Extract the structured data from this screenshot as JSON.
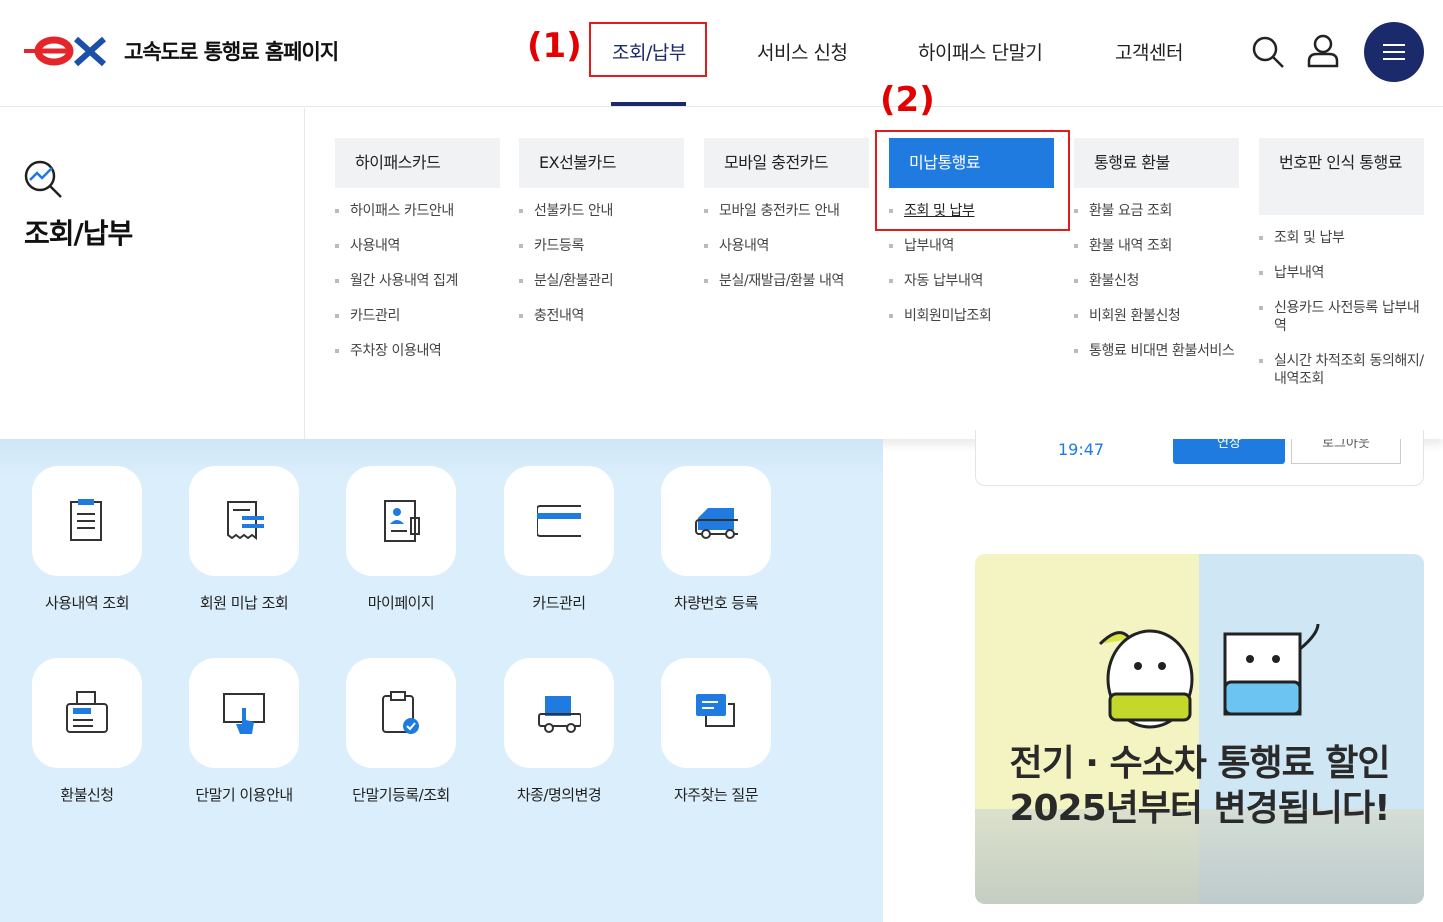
{
  "header": {
    "logo_mark": "ex",
    "site_title": "고속도로 통행료 홈페이지",
    "nav": [
      "조회/납부",
      "서비스 신청",
      "하이패스 단말기",
      "고객센터"
    ],
    "step1": "(1)",
    "step2": "(2)"
  },
  "mega": {
    "title": "조회/납부",
    "columns": [
      {
        "head": "하이패스카드",
        "items": [
          "하이패스 카드안내",
          "사용내역",
          "월간 사용내역 집계",
          "카드관리",
          "주차장 이용내역"
        ]
      },
      {
        "head": "EX선불카드",
        "items": [
          "선불카드 안내",
          "카드등록",
          "분실/환불관리",
          "충전내역"
        ]
      },
      {
        "head": "모바일 충전카드",
        "items": [
          "모바일 충전카드 안내",
          "사용내역",
          "분실/재발급/환불 내역"
        ]
      },
      {
        "head": "미납통행료",
        "items": [
          "조회 및 납부",
          "납부내역",
          "자동 납부내역",
          "비회원미납조회"
        ]
      },
      {
        "head": "통행료 환불",
        "items": [
          "환불 요금 조회",
          "환불 내역 조회",
          "환불신청",
          "비회원 환불신청",
          "통행료 비대면 환불서비스"
        ]
      },
      {
        "head": "번호판 인식 통행료",
        "items": [
          "조회 및 납부",
          "납부내역",
          "신용카드 사전등록 납부내역",
          "실시간 차적조회 동의해지/내역조회"
        ]
      }
    ]
  },
  "quick": [
    {
      "label": "사용내역 조회",
      "icon": "receipt-list-icon"
    },
    {
      "label": "회원 미납 조회",
      "icon": "bill-search-icon"
    },
    {
      "label": "마이페이지",
      "icon": "profile-doc-icon"
    },
    {
      "label": "카드관리",
      "icon": "card-icon"
    },
    {
      "label": "차량번호 등록",
      "icon": "car-icon"
    },
    {
      "label": "환불신청",
      "icon": "register-machine-icon"
    },
    {
      "label": "단말기 이용안내",
      "icon": "touch-screen-icon"
    },
    {
      "label": "단말기등록/조회",
      "icon": "clipboard-check-icon"
    },
    {
      "label": "차종/명의변경",
      "icon": "truck-change-icon"
    },
    {
      "label": "자주찾는 질문",
      "icon": "chat-icon"
    }
  ],
  "login_card": {
    "time": "19:47",
    "extend_label": "연장",
    "logout_label": "로그아웃"
  },
  "banner": {
    "line1": "전기 · 수소차 통행료 할인",
    "line2": "2025년부터 변경됩니다!"
  },
  "colors": {
    "navy": "#1b2a6b",
    "blue": "#1f7be0",
    "red": "#e21b1b"
  }
}
